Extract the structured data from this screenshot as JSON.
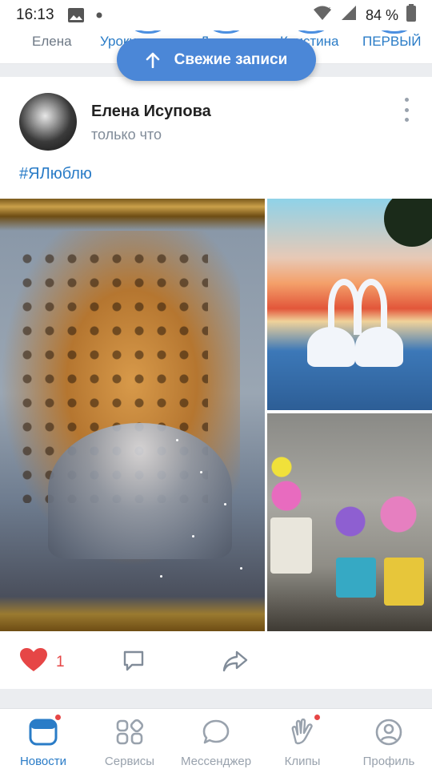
{
  "status_bar": {
    "time": "16:13",
    "battery_percent": "84 %"
  },
  "stories": [
    {
      "label": "Елена",
      "active": false
    },
    {
      "label": "Уроки ждва",
      "active": true
    },
    {
      "label": "Джеки",
      "active": true
    },
    {
      "label": "Кристина",
      "active": true
    },
    {
      "label": "ПЕРВЫЙ",
      "active": true
    }
  ],
  "fresh_button": {
    "label": "Свежие записи"
  },
  "post": {
    "author": "Елена Исупова",
    "time": "только что",
    "hashtag": "#ЯЛюблю",
    "photos": [
      "leopard-diamond-painting",
      "swans-sunset-diamond-painting",
      "flowers-pots-diamond-painting"
    ],
    "likes": "1"
  },
  "tabbar": {
    "items": [
      {
        "label": "Новости",
        "icon": "news-icon",
        "active": true,
        "badge": true
      },
      {
        "label": "Сервисы",
        "icon": "services-icon",
        "active": false,
        "badge": false
      },
      {
        "label": "Мессенджер",
        "icon": "messenger-icon",
        "active": false,
        "badge": false
      },
      {
        "label": "Клипы",
        "icon": "clips-icon",
        "active": false,
        "badge": true
      },
      {
        "label": "Профиль",
        "icon": "profile-icon",
        "active": false,
        "badge": false
      }
    ]
  },
  "colors": {
    "accent": "#2a7cc7",
    "button_blue": "#4b87d7",
    "like_red": "#e64646",
    "muted": "#99a2ad"
  }
}
